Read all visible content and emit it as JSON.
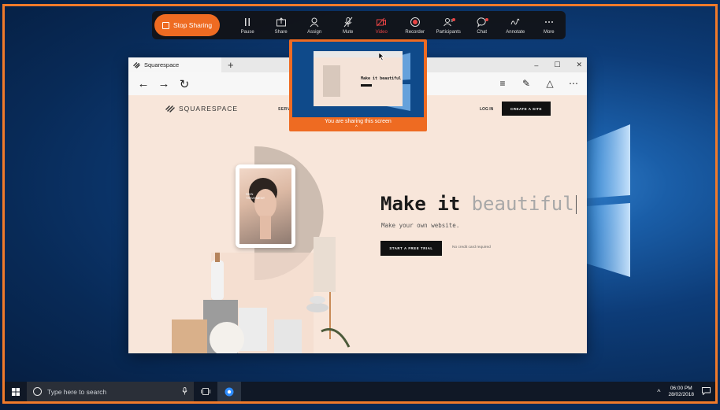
{
  "toolbar": {
    "stop_sharing": "Stop Sharing",
    "items": [
      {
        "label": "Pause",
        "icon": "pause-icon"
      },
      {
        "label": "Share",
        "icon": "share-icon"
      },
      {
        "label": "Assign",
        "icon": "assign-icon"
      },
      {
        "label": "Mute",
        "icon": "mic-muted-icon"
      },
      {
        "label": "Video",
        "icon": "video-off-icon"
      },
      {
        "label": "Recorder",
        "icon": "record-icon"
      },
      {
        "label": "Participants",
        "icon": "participants-icon"
      },
      {
        "label": "Chat",
        "icon": "chat-icon"
      },
      {
        "label": "Annotate",
        "icon": "annotate-icon"
      },
      {
        "label": "More",
        "icon": "more-icon"
      }
    ]
  },
  "share_preview": {
    "label": "You are sharing this screen",
    "mini_title": "Make it beautiful"
  },
  "browser": {
    "tab_title": "Squarespace",
    "new_tab": "+",
    "controls": {
      "minimize": "–",
      "maximize": "☐",
      "close": "✕"
    }
  },
  "squarespace": {
    "logo_text": "SQUARESPACE",
    "menu_partial": "SERV",
    "login": "LOG IN",
    "create_site": "CREATE A SITE",
    "headline_bold": "Make it ",
    "headline_light": "beautiful",
    "subline": "Make your own website.",
    "cta": "START A FREE TRIAL",
    "no_card": "No credit card required",
    "tablet_text": "SKIN TREATMENT"
  },
  "taskbar": {
    "search_placeholder": "Type here to search",
    "time": "06:00 PM",
    "date": "28/02/2018"
  },
  "colors": {
    "share_accent": "#ee6b22",
    "stop_button": "#ee6b22"
  }
}
